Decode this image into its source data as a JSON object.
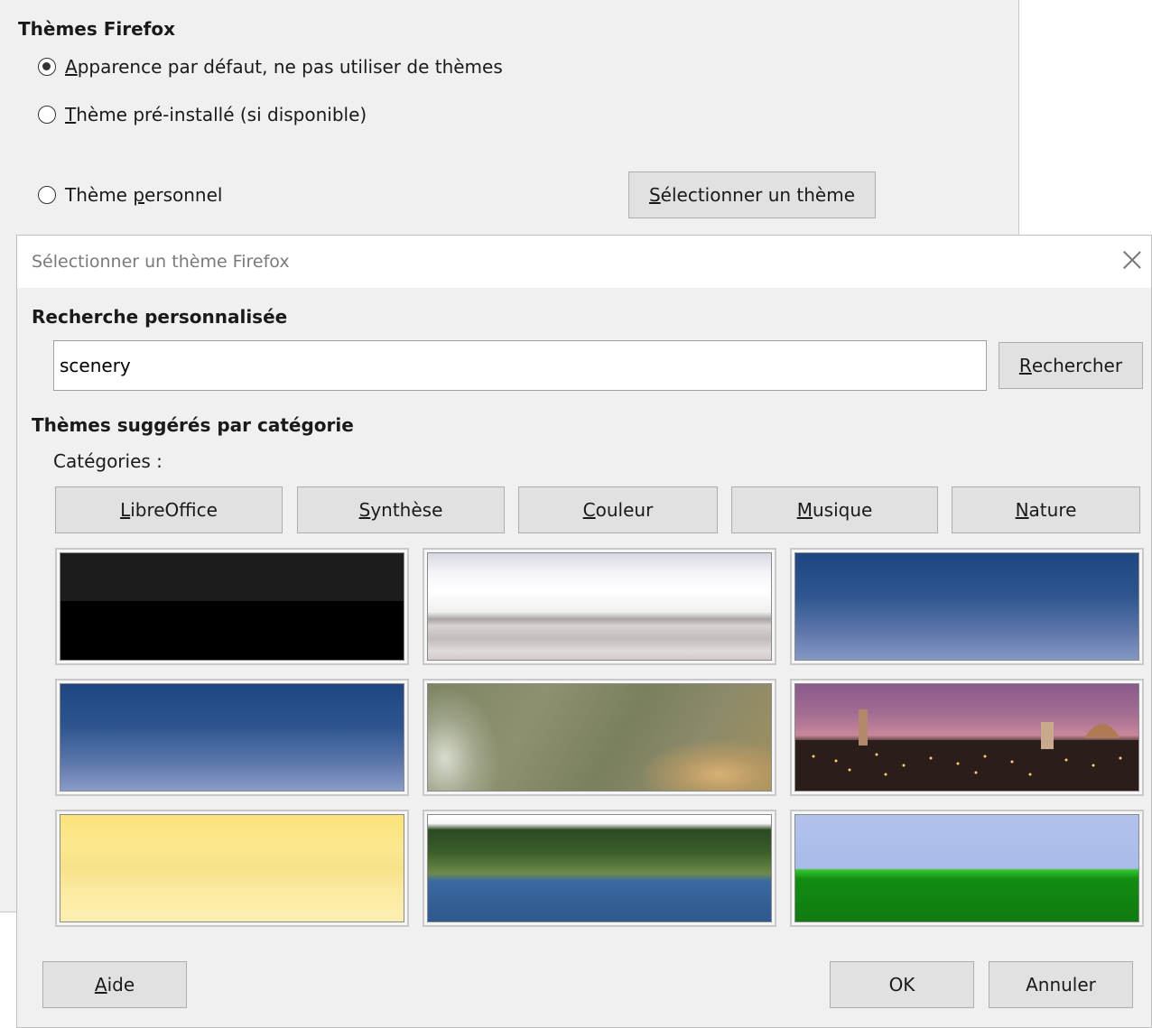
{
  "options": {
    "section_title": "Thèmes Firefox",
    "radios": [
      {
        "label_u": "A",
        "label_rest": "pparence par défaut, ne pas utiliser de thèmes",
        "checked": true
      },
      {
        "label_u": "T",
        "label_rest": "hème pré-installé (si disponible)",
        "checked": false
      },
      {
        "label_pre": "Thème ",
        "label_u": "p",
        "label_rest": "ersonnel",
        "checked": false
      }
    ],
    "select_button": {
      "u": "S",
      "rest": "électionner un thème"
    }
  },
  "dialog": {
    "title": "Sélectionner un thème Firefox",
    "search_section": "Recherche personnalisée",
    "search_value": "scenery",
    "search_button": {
      "u": "R",
      "rest": "echercher"
    },
    "suggested_section": "Thèmes suggérés par catégorie",
    "categories_label": "Catégories :",
    "categories": [
      {
        "u": "L",
        "rest": "ibreOffice"
      },
      {
        "u": "S",
        "rest": "ynthèse"
      },
      {
        "u": "C",
        "rest": "ouleur"
      },
      {
        "u": "M",
        "rest": "usique"
      },
      {
        "u": "N",
        "rest": "ature"
      }
    ],
    "thumbnails": [
      "black-theme",
      "silver-gradient-theme",
      "blue-gradient-theme",
      "blue-gradient-theme-2",
      "green-marble-theme",
      "florence-night-theme",
      "yellow-gradient-theme",
      "lake-landscape-theme",
      "green-hill-theme"
    ],
    "help_button": {
      "u": "A",
      "rest": "ide"
    },
    "ok_button": "OK",
    "cancel_button": "Annuler"
  }
}
